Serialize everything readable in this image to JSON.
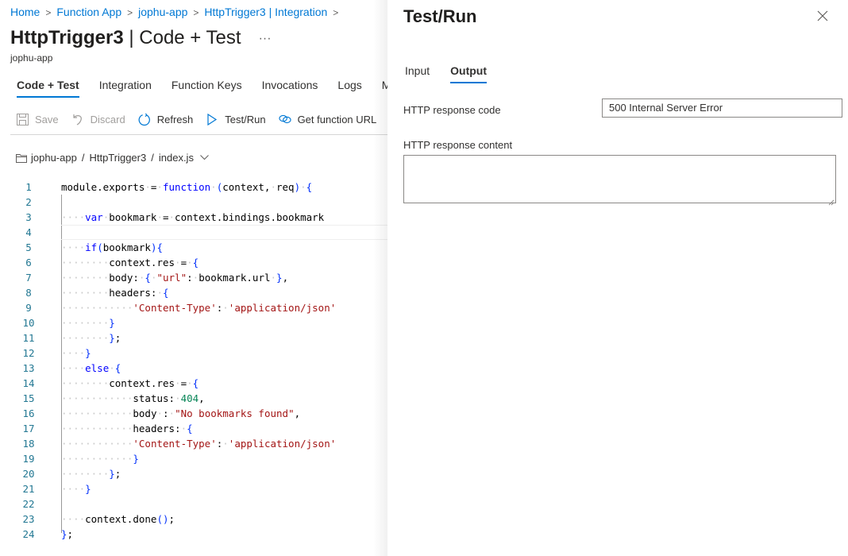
{
  "breadcrumb": [
    "Home",
    "Function App",
    "jophu-app",
    "HttpTrigger3 | Integration"
  ],
  "header": {
    "title_main": "HttpTrigger3",
    "title_sep": " | ",
    "title_sub": "Code + Test",
    "more": "···",
    "subtitle": "jophu-app"
  },
  "tabs": [
    {
      "label": "Code + Test",
      "active": true
    },
    {
      "label": "Integration"
    },
    {
      "label": "Function Keys"
    },
    {
      "label": "Invocations"
    },
    {
      "label": "Logs"
    },
    {
      "label": "Monitor"
    }
  ],
  "toolbar": {
    "save": "Save",
    "discard": "Discard",
    "refresh": "Refresh",
    "test_run": "Test/Run",
    "get_url": "Get function URL"
  },
  "filepath": {
    "app": "jophu-app",
    "function": "HttpTrigger3",
    "file": "index.js",
    "sep": "/"
  },
  "code": {
    "line_numbers": [
      "1",
      "2",
      "3",
      "4",
      "5",
      "6",
      "7",
      "8",
      "9",
      "10",
      "11",
      "12",
      "13",
      "14",
      "15",
      "16",
      "17",
      "18",
      "19",
      "20",
      "21",
      "22",
      "23",
      "24"
    ],
    "lines": [
      "module.exports = function (context, req) {",
      "",
      "    var bookmark = context.bindings.bookmark",
      "",
      "    if(bookmark){",
      "        context.res = {",
      "        body: { \"url\": bookmark.url },",
      "        headers: {",
      "            'Content-Type': 'application/json'",
      "        }",
      "        };",
      "    }",
      "    else {",
      "        context.res = {",
      "            status: 404,",
      "            body : \"No bookmarks found\",",
      "            headers: {",
      "            'Content-Type': 'application/json'",
      "            }",
      "        };",
      "    }",
      "",
      "    context.done();",
      "};"
    ],
    "current_line": 4
  },
  "panel": {
    "title": "Test/Run",
    "tabs": [
      {
        "label": "Input"
      },
      {
        "label": "Output",
        "active": true
      }
    ],
    "response_code_label": "HTTP response code",
    "response_code_value": "500 Internal Server Error",
    "response_content_label": "HTTP response content",
    "response_content_value": ""
  },
  "colors": {
    "accent": "#0078d4",
    "keyword": "#0000ff",
    "string": "#a31515",
    "number": "#098658",
    "line_number": "#237893"
  }
}
